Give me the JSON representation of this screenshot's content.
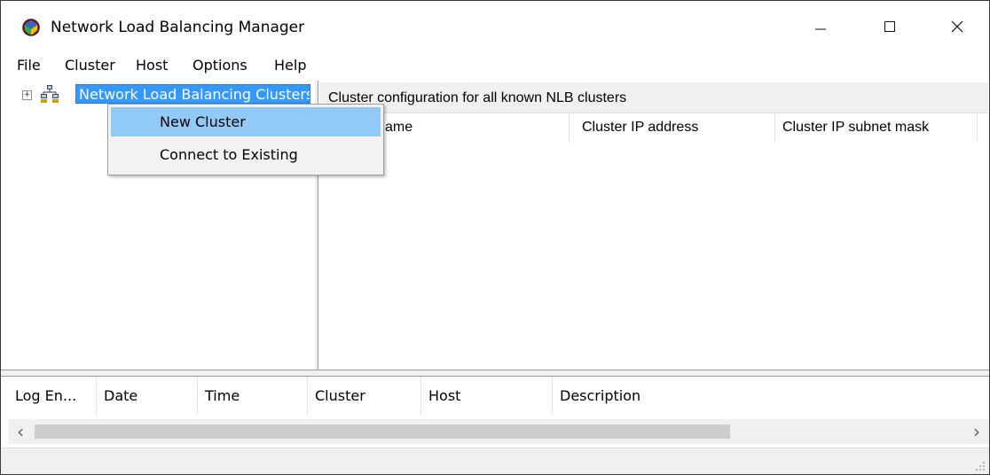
{
  "window": {
    "title": "Network Load Balancing Manager",
    "icons": {
      "app": "nlb-app-icon",
      "minimize": "minimize-icon",
      "maximize": "maximize-icon",
      "close": "close-icon"
    }
  },
  "menu": [
    "File",
    "Cluster",
    "Host",
    "Options",
    "Help"
  ],
  "tree": {
    "root_label": "Network Load Balancing Clusters",
    "expander": "⊞",
    "root_icon": "nlb-clusters-icon"
  },
  "right_pane": {
    "header": "Cluster configuration for all known NLB clusters",
    "columns": [
      "Cluster name",
      "Cluster IP address",
      "Cluster IP subnet mask"
    ]
  },
  "log": {
    "columns": [
      "Log En...",
      "Date",
      "Time",
      "Cluster",
      "Host",
      "Description"
    ]
  },
  "context_menu": {
    "items": [
      "New Cluster",
      "Connect to Existing"
    ],
    "highlighted_index": 0
  },
  "scroll": {
    "left_arrow": "‹",
    "right_arrow": "›"
  },
  "colors": {
    "selection": "#3399ff",
    "menu_highlight": "#91c9f7"
  }
}
